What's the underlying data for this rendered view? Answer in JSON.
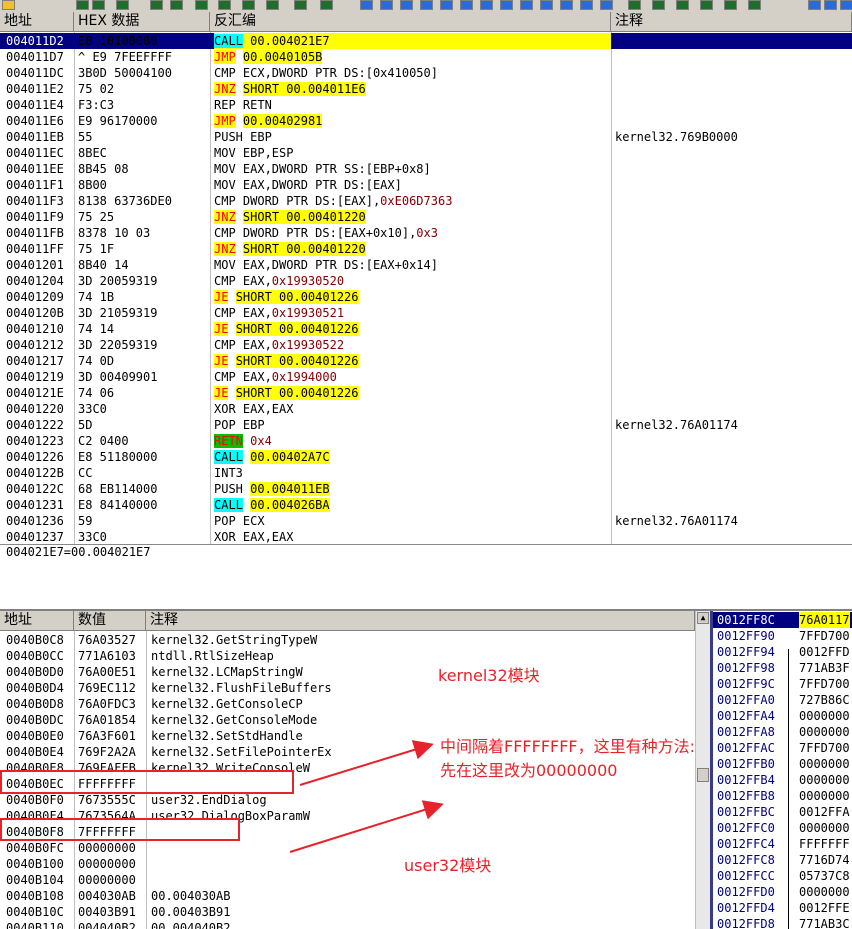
{
  "headers": {
    "addr": "地址",
    "hex": "HEX 数据",
    "disasm": "反汇编",
    "comment": "注释",
    "dump_addr": "地址",
    "dump_val": "数值",
    "dump_comment": "注释"
  },
  "disasm_rows": [
    {
      "addr": "004011D2",
      "hex": "E8 10100000",
      "parts": [
        {
          "t": "CALL",
          "c": "kw-call"
        },
        {
          "t": " "
        },
        {
          "t": "00.004021E7",
          "c": "yl"
        }
      ],
      "comment": ""
    },
    {
      "addr": "004011D7",
      "hex": "^ E9 7FEEFFFF",
      "parts": [
        {
          "t": "JMP",
          "c": "kw-jmp"
        },
        {
          "t": " "
        },
        {
          "t": "00.0040105B",
          "c": "yl"
        }
      ],
      "comment": ""
    },
    {
      "addr": "004011DC",
      "hex": "3B0D 50004100",
      "parts": [
        {
          "t": "CMP ECX,DWORD PTR DS:[0x410050]"
        }
      ],
      "comment": ""
    },
    {
      "addr": "004011E2",
      "hex": "75 02",
      "parts": [
        {
          "t": "JNZ",
          "c": "kw-j"
        },
        {
          "t": " "
        },
        {
          "t": "SHORT 00.004011E6",
          "c": "yl"
        }
      ],
      "comment": ""
    },
    {
      "addr": "004011E4",
      "hex": "F3:C3",
      "parts": [
        {
          "t": "REP RETN"
        }
      ],
      "comment": ""
    },
    {
      "addr": "004011E6",
      "hex": "E9 96170000",
      "parts": [
        {
          "t": "JMP",
          "c": "kw-jmp"
        },
        {
          "t": " "
        },
        {
          "t": "00.00402981",
          "c": "yl"
        }
      ],
      "comment": ""
    },
    {
      "addr": "004011EB",
      "hex": "55",
      "parts": [
        {
          "t": "PUSH EBP"
        }
      ],
      "comment": "kernel32.769B0000"
    },
    {
      "addr": "004011EC",
      "hex": "8BEC",
      "parts": [
        {
          "t": "MOV EBP,ESP"
        }
      ],
      "comment": ""
    },
    {
      "addr": "004011EE",
      "hex": "8B45 08",
      "parts": [
        {
          "t": "MOV EAX,DWORD PTR SS:[EBP+0x8]"
        }
      ],
      "comment": ""
    },
    {
      "addr": "004011F1",
      "hex": "8B00",
      "parts": [
        {
          "t": "MOV EAX,DWORD PTR DS:[EAX]"
        }
      ],
      "comment": ""
    },
    {
      "addr": "004011F3",
      "hex": "8138 63736DE0",
      "parts": [
        {
          "t": "CMP DWORD PTR DS:[EAX],"
        },
        {
          "t": "0xE06D7363",
          "c": "imm"
        }
      ],
      "comment": ""
    },
    {
      "addr": "004011F9",
      "hex": "75 25",
      "parts": [
        {
          "t": "JNZ",
          "c": "kw-j"
        },
        {
          "t": " "
        },
        {
          "t": "SHORT 00.00401220",
          "c": "yl"
        }
      ],
      "comment": ""
    },
    {
      "addr": "004011FB",
      "hex": "8378 10 03",
      "parts": [
        {
          "t": "CMP DWORD PTR DS:[EAX+0x10],"
        },
        {
          "t": "0x3",
          "c": "imm"
        }
      ],
      "comment": ""
    },
    {
      "addr": "004011FF",
      "hex": "75 1F",
      "parts": [
        {
          "t": "JNZ",
          "c": "kw-j"
        },
        {
          "t": " "
        },
        {
          "t": "SHORT 00.00401220",
          "c": "yl"
        }
      ],
      "comment": ""
    },
    {
      "addr": "00401201",
      "hex": "8B40 14",
      "parts": [
        {
          "t": "MOV EAX,DWORD PTR DS:[EAX+0x14]"
        }
      ],
      "comment": ""
    },
    {
      "addr": "00401204",
      "hex": "3D 20059319",
      "parts": [
        {
          "t": "CMP EAX,"
        },
        {
          "t": "0x19930520",
          "c": "imm"
        }
      ],
      "comment": ""
    },
    {
      "addr": "00401209",
      "hex": "74 1B",
      "parts": [
        {
          "t": "JE",
          "c": "kw-j"
        },
        {
          "t": " "
        },
        {
          "t": "SHORT 00.00401226",
          "c": "yl"
        }
      ],
      "comment": ""
    },
    {
      "addr": "0040120B",
      "hex": "3D 21059319",
      "parts": [
        {
          "t": "CMP EAX,"
        },
        {
          "t": "0x19930521",
          "c": "imm"
        }
      ],
      "comment": ""
    },
    {
      "addr": "00401210",
      "hex": "74 14",
      "parts": [
        {
          "t": "JE",
          "c": "kw-j"
        },
        {
          "t": " "
        },
        {
          "t": "SHORT 00.00401226",
          "c": "yl"
        }
      ],
      "comment": ""
    },
    {
      "addr": "00401212",
      "hex": "3D 22059319",
      "parts": [
        {
          "t": "CMP EAX,"
        },
        {
          "t": "0x19930522",
          "c": "imm"
        }
      ],
      "comment": ""
    },
    {
      "addr": "00401217",
      "hex": "74 0D",
      "parts": [
        {
          "t": "JE",
          "c": "kw-j"
        },
        {
          "t": " "
        },
        {
          "t": "SHORT 00.00401226",
          "c": "yl"
        }
      ],
      "comment": ""
    },
    {
      "addr": "00401219",
      "hex": "3D 00409901",
      "parts": [
        {
          "t": "CMP EAX,"
        },
        {
          "t": "0x1994000",
          "c": "imm"
        }
      ],
      "comment": ""
    },
    {
      "addr": "0040121E",
      "hex": "74 06",
      "parts": [
        {
          "t": "JE",
          "c": "kw-j"
        },
        {
          "t": " "
        },
        {
          "t": "SHORT 00.00401226",
          "c": "yl"
        }
      ],
      "comment": ""
    },
    {
      "addr": "00401220",
      "hex": "33C0",
      "parts": [
        {
          "t": "XOR EAX,EAX"
        }
      ],
      "comment": ""
    },
    {
      "addr": "00401222",
      "hex": "5D",
      "parts": [
        {
          "t": "POP EBP"
        }
      ],
      "comment": "kernel32.76A01174"
    },
    {
      "addr": "00401223",
      "hex": "C2 0400",
      "parts": [
        {
          "t": "RETN",
          "c": "kw-ret"
        },
        {
          "t": " "
        },
        {
          "t": "0x4",
          "c": "imm"
        }
      ],
      "comment": ""
    },
    {
      "addr": "00401226",
      "hex": "E8 51180000",
      "parts": [
        {
          "t": "CALL",
          "c": "kw-call"
        },
        {
          "t": " "
        },
        {
          "t": "00.00402A7C",
          "c": "yl"
        }
      ],
      "comment": ""
    },
    {
      "addr": "0040122B",
      "hex": "CC",
      "parts": [
        {
          "t": "INT3"
        }
      ],
      "comment": ""
    },
    {
      "addr": "0040122C",
      "hex": "68 EB114000",
      "parts": [
        {
          "t": "PUSH "
        },
        {
          "t": "00.004011EB",
          "c": "yl"
        }
      ],
      "comment": ""
    },
    {
      "addr": "00401231",
      "hex": "E8 84140000",
      "parts": [
        {
          "t": "CALL",
          "c": "kw-call"
        },
        {
          "t": " "
        },
        {
          "t": "00.004026BA",
          "c": "yl"
        }
      ],
      "comment": ""
    },
    {
      "addr": "00401236",
      "hex": "59",
      "parts": [
        {
          "t": "POP ECX"
        }
      ],
      "comment": "kernel32.76A01174"
    },
    {
      "addr": "00401237",
      "hex": "33C0",
      "parts": [
        {
          "t": "XOR EAX,EAX"
        }
      ],
      "comment": ""
    }
  ],
  "info_line": "004021E7=00.004021E7",
  "dump_rows": [
    {
      "addr": "0040B0C8",
      "val": "76A03527",
      "comment": "kernel32.GetStringTypeW"
    },
    {
      "addr": "0040B0CC",
      "val": "771A6103",
      "comment": "ntdll.RtlSizeHeap"
    },
    {
      "addr": "0040B0D0",
      "val": "76A00E51",
      "comment": "kernel32.LCMapStringW"
    },
    {
      "addr": "0040B0D4",
      "val": "769EC112",
      "comment": "kernel32.FlushFileBuffers"
    },
    {
      "addr": "0040B0D8",
      "val": "76A0FDC3",
      "comment": "kernel32.GetConsoleCP"
    },
    {
      "addr": "0040B0DC",
      "val": "76A01854",
      "comment": "kernel32.GetConsoleMode"
    },
    {
      "addr": "0040B0E0",
      "val": "76A3F601",
      "comment": "kernel32.SetStdHandle"
    },
    {
      "addr": "0040B0E4",
      "val": "769F2A2A",
      "comment": "kernel32.SetFilePointerEx"
    },
    {
      "addr": "0040B0E8",
      "val": "769FAFFB",
      "comment": "kernel32.WriteConsoleW"
    },
    {
      "addr": "0040B0EC",
      "val": "FFFFFFFF",
      "comment": ""
    },
    {
      "addr": "0040B0F0",
      "val": "7673555C",
      "comment": "user32.EndDialog"
    },
    {
      "addr": "0040B0F4",
      "val": "7673564A",
      "comment": "user32.DialogBoxParamW"
    },
    {
      "addr": "0040B0F8",
      "val": "7FFFFFFF",
      "comment": ""
    },
    {
      "addr": "0040B0FC",
      "val": "00000000",
      "comment": ""
    },
    {
      "addr": "0040B100",
      "val": "00000000",
      "comment": ""
    },
    {
      "addr": "0040B104",
      "val": "00000000",
      "comment": ""
    },
    {
      "addr": "0040B108",
      "val": "004030AB",
      "comment": "00.004030AB"
    },
    {
      "addr": "0040B10C",
      "val": "00403B91",
      "comment": "00.00403B91"
    },
    {
      "addr": "0040B110",
      "val": "004040B2",
      "comment": "00.004040B2"
    }
  ],
  "stack_rows": [
    {
      "addr": "0012FF8C",
      "val": "76A0117"
    },
    {
      "addr": "0012FF90",
      "val": "7FFD700"
    },
    {
      "addr": "0012FF94",
      "val": "0012FFD"
    },
    {
      "addr": "0012FF98",
      "val": "771AB3F"
    },
    {
      "addr": "0012FF9C",
      "val": "7FFD700"
    },
    {
      "addr": "0012FFA0",
      "val": "727B86C"
    },
    {
      "addr": "0012FFA4",
      "val": "0000000"
    },
    {
      "addr": "0012FFA8",
      "val": "0000000"
    },
    {
      "addr": "0012FFAC",
      "val": "7FFD700"
    },
    {
      "addr": "0012FFB0",
      "val": "0000000"
    },
    {
      "addr": "0012FFB4",
      "val": "0000000"
    },
    {
      "addr": "0012FFB8",
      "val": "0000000"
    },
    {
      "addr": "0012FFBC",
      "val": "0012FFA"
    },
    {
      "addr": "0012FFC0",
      "val": "0000000"
    },
    {
      "addr": "0012FFC4",
      "val": "FFFFFFF"
    },
    {
      "addr": "0012FFC8",
      "val": "7716D74"
    },
    {
      "addr": "0012FFCC",
      "val": "05737C8"
    },
    {
      "addr": "0012FFD0",
      "val": "0000000"
    },
    {
      "addr": "0012FFD4",
      "val": "0012FFE"
    },
    {
      "addr": "0012FFD8",
      "val": "771AB3C"
    }
  ],
  "annotations": {
    "kernel32": "kernel32模块",
    "note1": "中间隔着FFFFFFFF，这里有种方法:",
    "note2": "先在这里改为00000000",
    "user32": "user32模块"
  },
  "colors": {
    "selected_row": "#000080",
    "annotation_red": "#e8222a",
    "highlight_yellow": "#ffff00",
    "call_cyan": "#00ffff"
  }
}
